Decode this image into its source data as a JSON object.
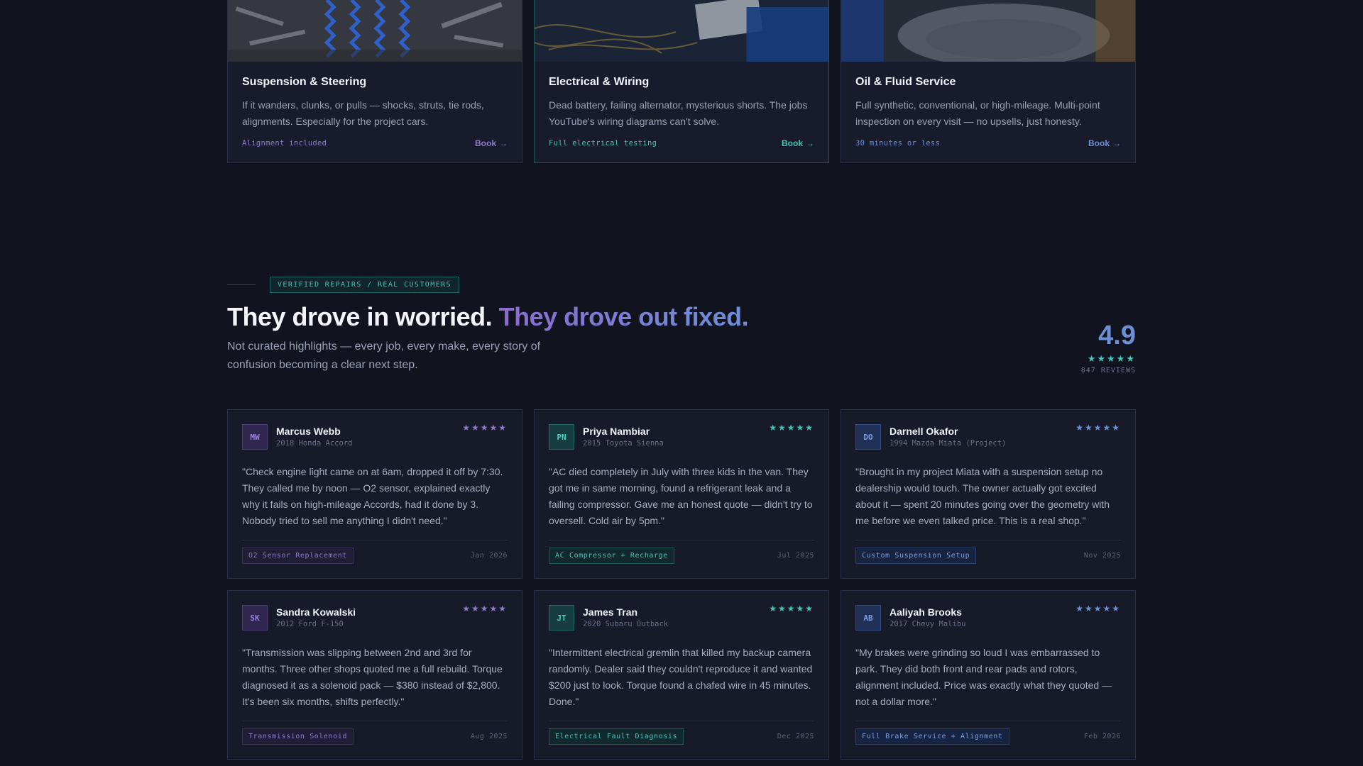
{
  "services": [
    {
      "title": "Suspension & Steering",
      "description": "If it wanders, clunks, or pulls — shocks, struts, tie rods, alignments. Especially for the project cars.",
      "tag": "Alignment included",
      "book_label": "Book",
      "accent": "#8f7bc8"
    },
    {
      "title": "Electrical & Wiring",
      "description": "Dead battery, failing alternator, mysterious shorts. The jobs YouTube's wiring diagrams can't solve.",
      "tag": "Full electrical testing",
      "book_label": "Book",
      "accent": "#43c5b6"
    },
    {
      "title": "Oil & Fluid Service",
      "description": "Full synthetic, conventional, or high-mileage. Multi-point inspection on every visit — no upsells, just honesty.",
      "tag": "30 minutes or less",
      "book_label": "Book",
      "accent": "#6d8fd6"
    }
  ],
  "testimonials": {
    "eyebrow": "VERIFIED REPAIRS / REAL CUSTOMERS",
    "headline_a": "They drove in worried.",
    "headline_b": "They drove out fixed.",
    "subhead": "Not curated highlights — every job, every make, every story of confusion becoming a clear next step.",
    "score": "4.9",
    "score_stars": "★★★★★",
    "review_count": "847 REVIEWS",
    "colors": {
      "purple": "#8f7bc8",
      "teal": "#43c5b6",
      "blue": "#6d8fd6"
    }
  },
  "reviews": [
    {
      "initials": "MW",
      "name": "Marcus Webb",
      "car": "2018 Honda Accord",
      "stars": "★★★★★",
      "quote": "\"Check engine light came on at 6am, dropped it off by 7:30. They called me by noon — O2 sensor, explained exactly why it fails on high-mileage Accords, had it done by 3. Nobody tried to sell me anything I didn't need.\"",
      "service": "O2 Sensor Replacement",
      "date": "Jan 2026",
      "accent": "purple"
    },
    {
      "initials": "PN",
      "name": "Priya Nambiar",
      "car": "2015 Toyota Sienna",
      "stars": "★★★★★",
      "quote": "\"AC died completely in July with three kids in the van. They got me in same morning, found a refrigerant leak and a failing compressor. Gave me an honest quote — didn't try to oversell. Cold air by 5pm.\"",
      "service": "AC Compressor + Recharge",
      "date": "Jul 2025",
      "accent": "teal"
    },
    {
      "initials": "DO",
      "name": "Darnell Okafor",
      "car": "1994 Mazda Miata (Project)",
      "stars": "★★★★★",
      "quote": "\"Brought in my project Miata with a suspension setup no dealership would touch. The owner actually got excited about it — spent 20 minutes going over the geometry with me before we even talked price. This is a real shop.\"",
      "service": "Custom Suspension Setup",
      "date": "Nov 2025",
      "accent": "blue"
    },
    {
      "initials": "SK",
      "name": "Sandra Kowalski",
      "car": "2012 Ford F-150",
      "stars": "★★★★★",
      "quote": "\"Transmission was slipping between 2nd and 3rd for months. Three other shops quoted me a full rebuild. Torque diagnosed it as a solenoid pack — $380 instead of $2,800. It's been six months, shifts perfectly.\"",
      "service": "Transmission Solenoid",
      "date": "Aug 2025",
      "accent": "purple"
    },
    {
      "initials": "JT",
      "name": "James Tran",
      "car": "2020 Subaru Outback",
      "stars": "★★★★★",
      "quote": "\"Intermittent electrical gremlin that killed my backup camera randomly. Dealer said they couldn't reproduce it and wanted $200 just to look. Torque found a chafed wire in 45 minutes. Done.\"",
      "service": "Electrical Fault Diagnosis",
      "date": "Dec 2025",
      "accent": "teal"
    },
    {
      "initials": "AB",
      "name": "Aaliyah Brooks",
      "car": "2017 Chevy Malibu",
      "stars": "★★★★★",
      "quote": "\"My brakes were grinding so loud I was embarrassed to park. They did both front and rear pads and rotors, alignment included. Price was exactly what they quoted — not a dollar more.\"",
      "service": "Full Brake Service + Alignment",
      "date": "Feb 2026",
      "accent": "blue"
    }
  ]
}
